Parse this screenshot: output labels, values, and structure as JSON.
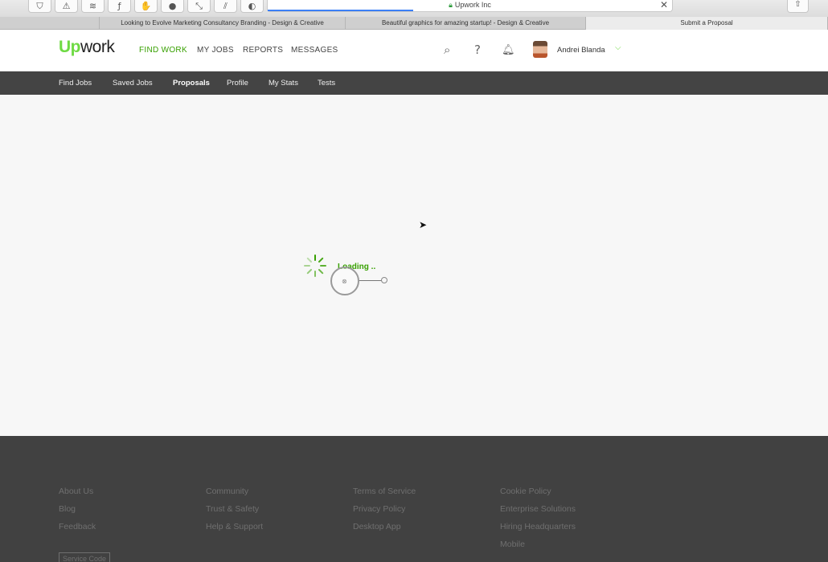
{
  "browser": {
    "address": "Upwork Inc",
    "tabs": [
      {
        "label": "Looking to Evolve Marketing Consultancy Branding - Design & Creative"
      },
      {
        "label": "Beautiful graphics for amazing startup! - Design & Creative"
      },
      {
        "label": "Submit a Proposal"
      }
    ]
  },
  "header": {
    "logo_up": "Up",
    "logo_work": "work",
    "nav": [
      "FIND WORK",
      "MY JOBS",
      "REPORTS",
      "MESSAGES"
    ],
    "user_name": "Andrei Blanda"
  },
  "subnav": [
    "Find Jobs",
    "Saved Jobs",
    "Proposals",
    "Profile",
    "My Stats",
    "Tests"
  ],
  "content": {
    "loading_text": "Loading .."
  },
  "footer": {
    "columns": [
      [
        "About Us",
        "Blog",
        "Feedback"
      ],
      [
        "Community",
        "Trust & Safety",
        "Help & Support"
      ],
      [
        "Terms of Service",
        "Privacy Policy",
        "Desktop App"
      ],
      [
        "Cookie Policy",
        "Enterprise Solutions",
        "Hiring Headquarters",
        "Mobile"
      ]
    ],
    "service_code": "Service Code"
  },
  "colors": {
    "brand_green": "#6fda44",
    "active_green": "#37a000",
    "subnav_bg": "#444444",
    "footer_bg": "#414141"
  }
}
